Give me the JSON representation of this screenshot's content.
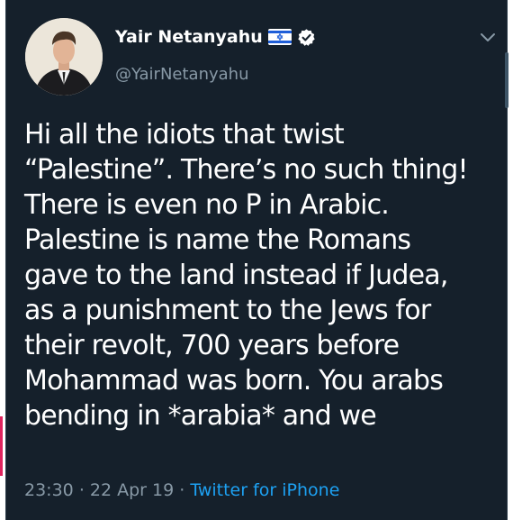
{
  "user": {
    "display_name": "Yair Netanyahu",
    "handle": "@YairNetanyahu",
    "flag_icon": "israel-flag-icon",
    "verified_icon": "verified-badge-icon"
  },
  "tweet": {
    "lines": [
      "Hi all the idiots that twist",
      "“Palestine”. There’s no such thing!",
      "There is even no P in Arabic.",
      "Palestine is name the Romans",
      "gave to the land instead if Judea,",
      "as a punishment to the Jews for",
      "their revolt, 700 years before",
      "Mohammad was born. You arabs",
      "bending in *arabia* and we"
    ]
  },
  "meta": {
    "time": "23:30",
    "separator": "·",
    "date": "22 Apr 19",
    "source": "Twitter for iPhone"
  },
  "colors": {
    "background": "#15202b",
    "text": "#ffffff",
    "muted": "#8899a6",
    "accent": "#1da1f2"
  }
}
